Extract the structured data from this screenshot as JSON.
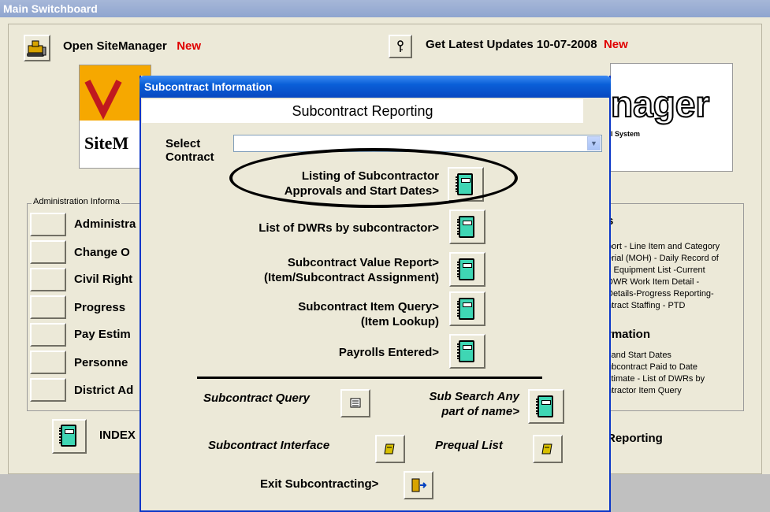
{
  "main": {
    "title": "Main Switchboard",
    "open_sitemanager": "Open SiteManager",
    "new1": "New",
    "updates_label": "Get Latest Updates 10-07-2008",
    "new2": "New",
    "logo_left_text": "SiteM",
    "logo_right_text": "nager",
    "logo_right_sub": "l System",
    "admin_legend": "Administration Informa",
    "admin_items": [
      "Administra",
      "Change O",
      "Civil Right",
      "Progress",
      "Pay Estim",
      "Personne",
      "District Ad"
    ],
    "index_label": "INDEX",
    "right_head1": "s",
    "right_lines1": [
      "port - Line Item and Category",
      "erial (MOH) - Daily Record of",
      "s Equipment List -Current",
      "DWR Work Item Detail -",
      "Details-Progress Reporting-",
      "ntract Staffing - PTD"
    ],
    "right_head2": "rmation",
    "right_lines2": [
      "l and Start Dates",
      "ubcontract Paid to Date",
      "stimate  - List of DWRs by",
      "ntractor Item Query"
    ],
    "reporting_label": "Reporting"
  },
  "dialog": {
    "title": "Subcontract Information",
    "subtitle": "Subcontract Reporting",
    "select_label_1": "Select",
    "select_label_2": "Contract",
    "select_value": "",
    "reports": [
      {
        "line1": "Listing of Subcontractor",
        "line2": "Approvals and Start Dates>"
      },
      {
        "line1": "List of DWRs by subcontractor>",
        "line2": ""
      },
      {
        "line1": "Subcontract Value Report>",
        "line2": "(Item/Subcontract Assignment)"
      },
      {
        "line1": "Subcontract Item Query>",
        "line2": "(Item Lookup)"
      },
      {
        "line1": "Payrolls Entered>",
        "line2": ""
      }
    ],
    "subcontract_query": "Subcontract Query",
    "sub_search_1": "Sub Search Any",
    "sub_search_2": "part of name>",
    "subcontract_interface": "Subcontract Interface",
    "prequal_list": "Prequal List",
    "exit_label": "Exit Subcontracting>"
  },
  "colors": {
    "accent_title": "#0a5fd8",
    "new_red": "#e00000",
    "book_teal": "#3fd6b4"
  }
}
